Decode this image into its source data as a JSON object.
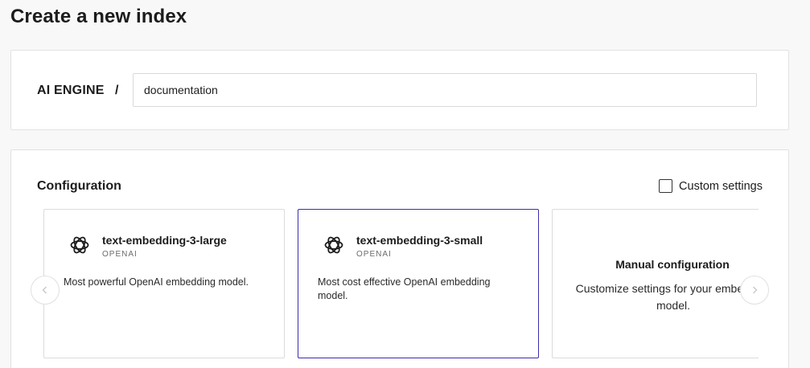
{
  "page": {
    "title": "Create a new index"
  },
  "index_name": {
    "engine_label": "AI ENGINE",
    "separator": "/",
    "value": "documentation"
  },
  "configuration": {
    "title": "Configuration",
    "custom_settings_label": "Custom settings",
    "custom_settings_checked": false,
    "cards": [
      {
        "name": "text-embedding-3-large",
        "provider": "OPENAI",
        "description": "Most powerful OpenAI embedding model.",
        "icon": "openai-logo-icon",
        "selected": false
      },
      {
        "name": "text-embedding-3-small",
        "provider": "OPENAI",
        "description": "Most cost effective OpenAI embedding model.",
        "icon": "openai-logo-icon",
        "selected": true
      }
    ],
    "manual": {
      "title": "Manual configuration",
      "description": "Customize settings for your embedding model."
    },
    "nav": {
      "prev_icon": "chevron-left-icon",
      "next_icon": "chevron-right-icon"
    }
  },
  "colors": {
    "selected_border": "#3b2bb0",
    "background": "#f8f8f8"
  }
}
